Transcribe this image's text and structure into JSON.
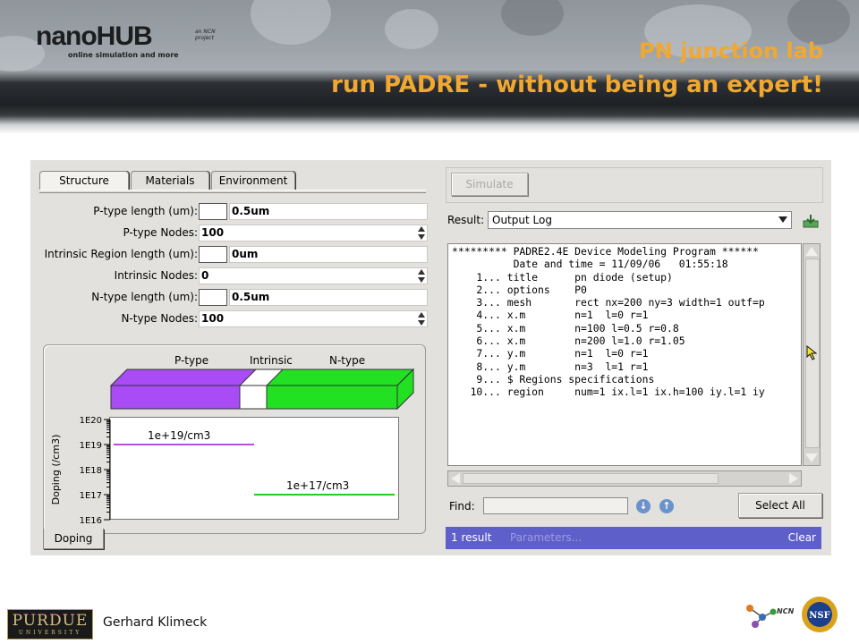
{
  "header": {
    "logo_word_a": "nano",
    "logo_word_b": "HUB",
    "logo_tagline": "online simulation and more",
    "logo_partner": "an NCN project",
    "title_line1": "PN junction lab",
    "title_line2": "run PADRE - without being an expert!"
  },
  "app": {
    "tabs": [
      "Structure",
      "Materials",
      "Environment"
    ],
    "active_tab": "Structure",
    "form": [
      {
        "label": "P-type length (um):",
        "value": "0.5um"
      },
      {
        "label": "P-type Nodes:",
        "value": "100"
      },
      {
        "label": "Intrinsic Region length (um):",
        "value": "0um"
      },
      {
        "label": "Intrinsic Nodes:",
        "value": "0"
      },
      {
        "label": "N-type length (um):",
        "value": "0.5um"
      },
      {
        "label": "N-type Nodes:",
        "value": "100"
      }
    ],
    "structure_labels": {
      "p": "P-type",
      "i": "Intrinsic",
      "n": "N-type"
    },
    "colors": {
      "p_type": "#a94cf5",
      "intrinsic": "#ffffff",
      "n_type": "#22e022",
      "status_bar": "#5f5fc9"
    },
    "doping_tab": "Doping",
    "simulate_label": "Simulate",
    "result_label": "Result:",
    "result_value": "Output Log",
    "log_lines": [
      "********* PADRE2.4E Device Modeling Program ******",
      "",
      "          Date and time = 11/09/06   01:55:18",
      "",
      "",
      "    1... title      pn diode (setup)",
      "    2... options    P0",
      "",
      "",
      "    3... mesh       rect nx=200 ny=3 width=1 outf=p",
      "    4... x.m        n=1  l=0 r=1",
      "    5... x.m        n=100 l=0.5 r=0.8",
      "    6... x.m        n=200 l=1.0 r=1.05",
      "    7... y.m        n=1  l=0 r=1",
      "    8... y.m        n=3  l=1 r=1",
      "",
      "    9... $ Regions specifications",
      "   10... region     num=1 ix.l=1 ix.h=100 iy.l=1 iy"
    ],
    "find_label": "Find:",
    "find_value": "",
    "select_all_label": "Select All",
    "status": {
      "count": "1 result",
      "params": "Parameters...",
      "clear": "Clear"
    }
  },
  "chart_data": {
    "type": "line",
    "title": "",
    "xlabel": "",
    "ylabel": "Doping (/cm3)",
    "y_scale": "log",
    "ylim": [
      1e+16,
      1e+20
    ],
    "y_tick_labels": [
      "1E20",
      "1E19",
      "1E18",
      "1E17",
      "1E16"
    ],
    "x": [
      0,
      0.5,
      1.0
    ],
    "series": [
      {
        "name": "P-type",
        "x": [
          0,
          0.5
        ],
        "values": [
          1e+19,
          1e+19
        ],
        "color": "#b84de6"
      },
      {
        "name": "N-type",
        "x": [
          0.5,
          1.0
        ],
        "values": [
          1e+17,
          1e+17
        ],
        "color": "#22cc22"
      }
    ],
    "annotations": [
      "1e+19/cm3",
      "1e+17/cm3"
    ]
  },
  "footer": {
    "university": "PURDUE",
    "university_sub": "UNIVERSITY",
    "author": "Gerhard Klimeck",
    "ncn_text": "NCN",
    "nsf_text": "NSF"
  }
}
